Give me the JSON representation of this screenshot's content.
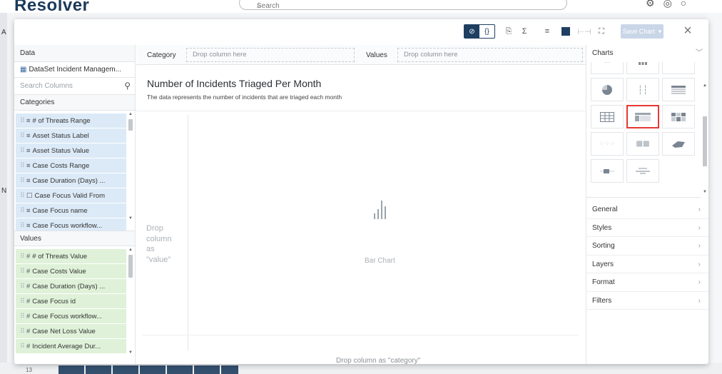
{
  "background": {
    "logo": "Resolver",
    "search_placeholder": "Search",
    "left_letters": [
      "A",
      "N"
    ],
    "row_number": "13"
  },
  "toolbar": {
    "save_label": "Save Chart",
    "save_dropdown": "▾",
    "close": "×",
    "view_toggle_left": "⊘",
    "view_toggle_right": "{}"
  },
  "data_panel": {
    "header": "Data",
    "dataset": "DataSet Incident Managem...",
    "search_placeholder": "Search Columns",
    "categories_header": "Categories",
    "categories": [
      {
        "icon": "≡",
        "label": "# of Threats Range"
      },
      {
        "icon": "≡",
        "label": "Asset Status Label"
      },
      {
        "icon": "≡",
        "label": "Asset Status Value"
      },
      {
        "icon": "≡",
        "label": "Case Costs Range"
      },
      {
        "icon": "≡",
        "label": "Case Duration (Days) ..."
      },
      {
        "icon": "☐",
        "label": "Case Focus Valid From"
      },
      {
        "icon": "≡",
        "label": "Case Focus name"
      },
      {
        "icon": "≡",
        "label": "Case Focus workflow..."
      }
    ],
    "values_header": "Values",
    "values": [
      {
        "icon": "#",
        "label": "# of Threats Value"
      },
      {
        "icon": "#",
        "label": "Case Costs Value"
      },
      {
        "icon": "#",
        "label": "Case Duration (Days) ..."
      },
      {
        "icon": "#",
        "label": "Case Focus id"
      },
      {
        "icon": "#",
        "label": "Case Focus workflow..."
      },
      {
        "icon": "#",
        "label": "Case Net Loss Value"
      },
      {
        "icon": "#",
        "label": "Incident Average Dur..."
      }
    ]
  },
  "center": {
    "category_label": "Category",
    "category_placeholder": "Drop column here",
    "values_label": "Values",
    "values_placeholder": "Drop column here",
    "title": "Number of Incidents Triaged Per Month",
    "subtitle": "The data represents the number of incidents that are triaged each month",
    "drop_value_lines": [
      "Drop",
      "column",
      "as",
      "\"value\""
    ],
    "empty_chart_label": "Bar Chart",
    "drop_category": "Drop column as \"category\""
  },
  "charts_panel": {
    "header": "Charts",
    "sections": [
      "General",
      "Styles",
      "Sorting",
      "Layers",
      "Format",
      "Filters"
    ]
  },
  "colors": {
    "accent": "#1f3f62",
    "category_bg": "#dceaf7",
    "value_bg": "#dff2d9",
    "highlight": "#e53935"
  }
}
